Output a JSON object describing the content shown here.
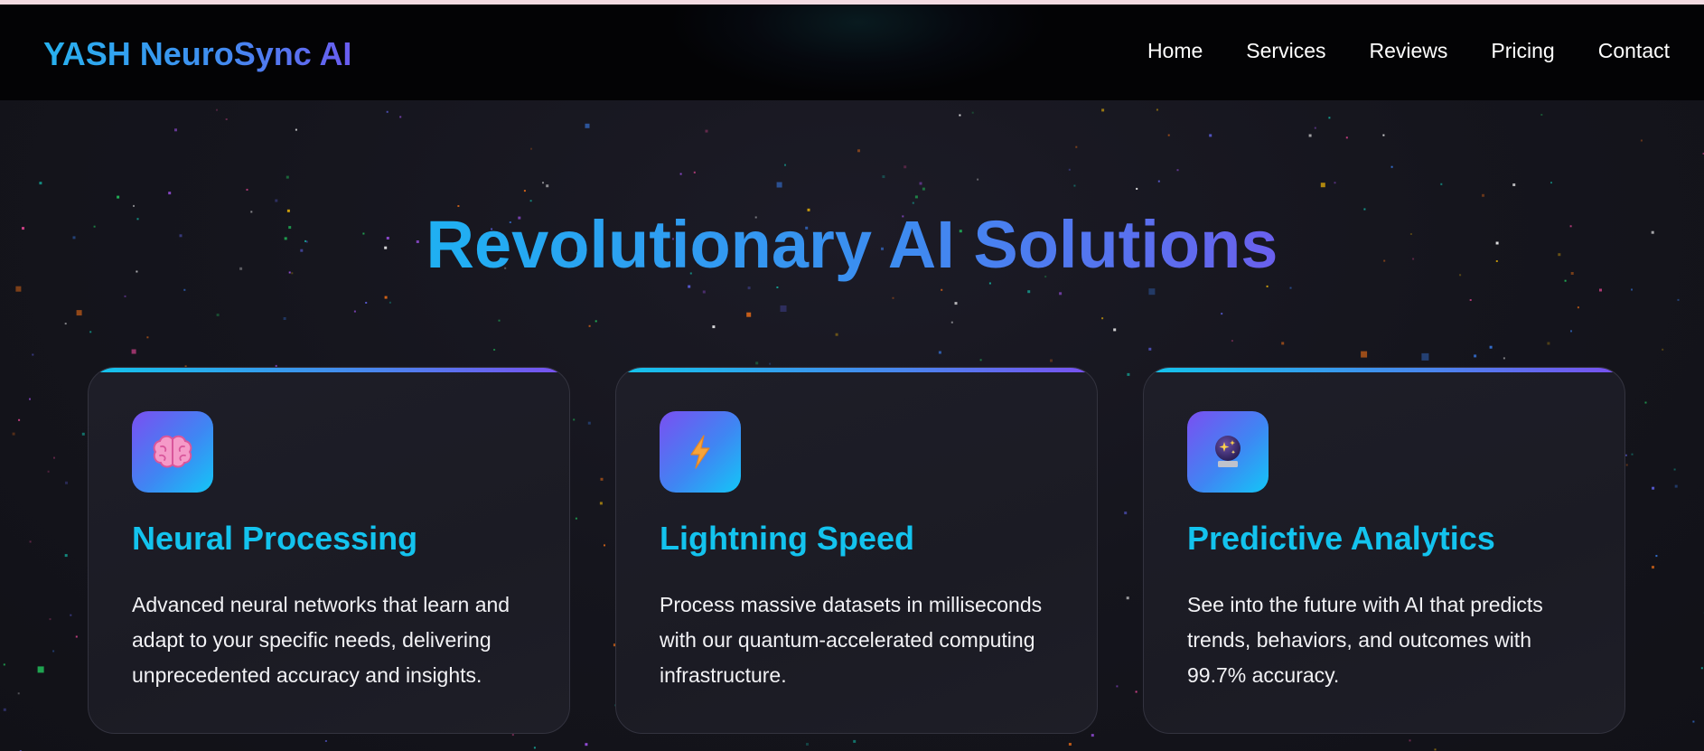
{
  "brand": {
    "name": "YASH NeuroSync AI",
    "accent_cyan": "#13c3ee",
    "accent_blue": "#3f8ef0",
    "accent_purple": "#6a5cf0"
  },
  "nav": {
    "links": [
      "Home",
      "Services",
      "Reviews",
      "Pricing",
      "Contact"
    ]
  },
  "hero": {
    "title": "Revolutionary AI Solutions"
  },
  "features": [
    {
      "icon": "brain-icon",
      "title": "Neural Processing",
      "description": "Advanced neural networks that learn and adapt to your specific needs, delivering unprecedented accuracy and insights."
    },
    {
      "icon": "lightning-icon",
      "title": "Lightning Speed",
      "description": "Process massive datasets in milliseconds with our quantum-accelerated computing infrastructure."
    },
    {
      "icon": "crystal-ball-icon",
      "title": "Predictive Analytics",
      "description": "See into the future with AI that predicts trends, behaviors, and outcomes with 99.7% accuracy."
    }
  ]
}
